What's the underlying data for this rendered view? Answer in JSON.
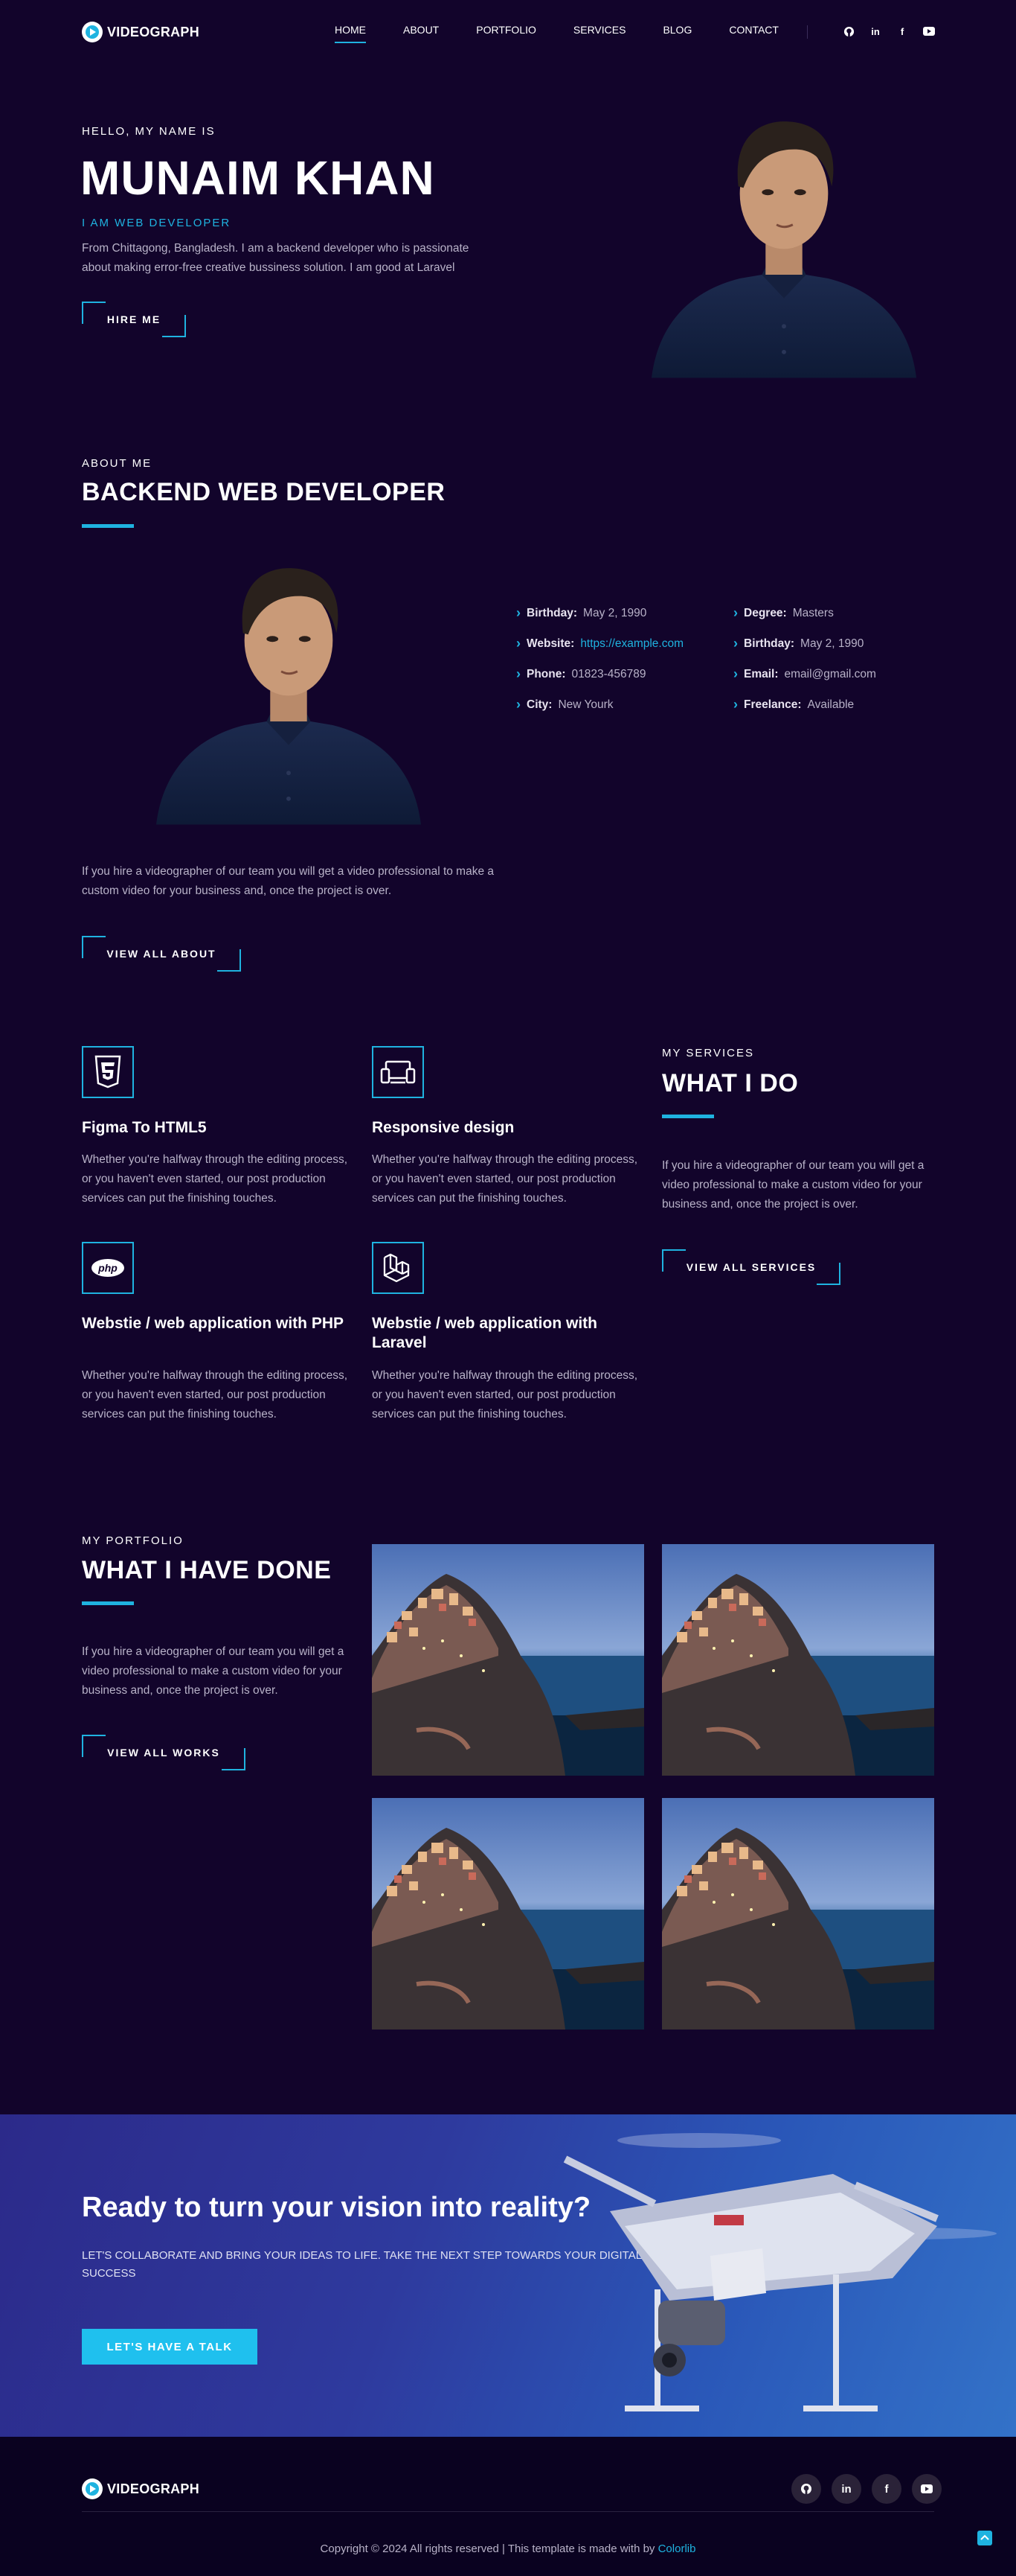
{
  "header": {
    "logo_text": "VIDEOGRAPH",
    "nav": [
      {
        "label": "HOME",
        "active": true
      },
      {
        "label": "ABOUT",
        "active": false
      },
      {
        "label": "PORTFOLIO",
        "active": false
      },
      {
        "label": "SERVICES",
        "active": false
      },
      {
        "label": "BLOG",
        "active": false
      },
      {
        "label": "CONTACT",
        "active": false
      }
    ],
    "social_icons": [
      "github-icon",
      "linkedin-icon",
      "facebook-icon",
      "youtube-icon"
    ]
  },
  "hero": {
    "eyebrow": "HELLO, MY NAME IS",
    "name": "MUNAIM KHAN",
    "role": "I AM WEB DEVELOPER",
    "description": "From Chittagong, Bangladesh. I am a backend developer who is passionate about making error-free creative bussiness solution. I am good at Laravel",
    "button": "HIRE ME"
  },
  "about": {
    "eyebrow": "ABOUT ME",
    "title": "BACKEND WEB DEVELOPER",
    "info_left": [
      {
        "label": "Birthday:",
        "value": "May 2, 1990"
      },
      {
        "label": "Website:",
        "value": "https://example.com"
      },
      {
        "label": "Phone:",
        "value": "01823-456789"
      },
      {
        "label": "City:",
        "value": "New Yourk"
      }
    ],
    "info_right": [
      {
        "label": "Degree:",
        "value": "Masters"
      },
      {
        "label": "Birthday:",
        "value": "May 2, 1990"
      },
      {
        "label": "Email:",
        "value": "email@gmail.com"
      },
      {
        "label": "Freelance:",
        "value": "Available"
      }
    ],
    "description": "If you hire a videographer of our team you will get a video professional to make a custom video for your business and, once the project is over.",
    "button": "VIEW ALL ABOUT"
  },
  "services": {
    "eyebrow": "MY SERVICES",
    "title": "WHAT I DO",
    "description": "If you hire a videographer of our team you will get a video professional to make a custom video for your business and, once the project is over.",
    "button": "VIEW ALL SERVICES",
    "items": [
      {
        "icon": "html5-icon",
        "title": "Figma To HTML5",
        "text": "Whether you're halfway through the editing process, or you haven't even started, our post production services can put the finishing touches."
      },
      {
        "icon": "devices-icon",
        "title": "Responsive design",
        "text": "Whether you're halfway through the editing process, or you haven't even started, our post production services can put the finishing touches."
      },
      {
        "icon": "php-icon",
        "title": "Webstie / web application with PHP",
        "text": "Whether you're halfway through the editing process, or you haven't even started, our post production services can put the finishing touches."
      },
      {
        "icon": "laravel-icon",
        "title": "Webstie / web application with Laravel",
        "text": "Whether you're halfway through the editing process, or you haven't even started, our post production services can put the finishing touches."
      }
    ]
  },
  "portfolio": {
    "eyebrow": "MY PORTFOLIO",
    "title": "WHAT I HAVE DONE",
    "description": "If you hire a videographer of our team you will get a video professional to make a custom video for your business and, once the project is over.",
    "button": "VIEW ALL WORKS"
  },
  "cta": {
    "title": "Ready to turn your vision into reality?",
    "subtitle": "LET'S COLLABORATE AND BRING YOUR IDEAS TO LIFE. TAKE THE NEXT STEP TOWARDS YOUR DIGITAL SUCCESS",
    "button": "LET'S HAVE A TALK"
  },
  "footer": {
    "logo_text": "VIDEOGRAPH",
    "copyright": "Copyright © 2024 All rights reserved | This template is made with  by ",
    "credit": "Colorlib"
  },
  "colors": {
    "background": "#12042b",
    "accent": "#1fb3e0",
    "footer": "#0a0220"
  }
}
